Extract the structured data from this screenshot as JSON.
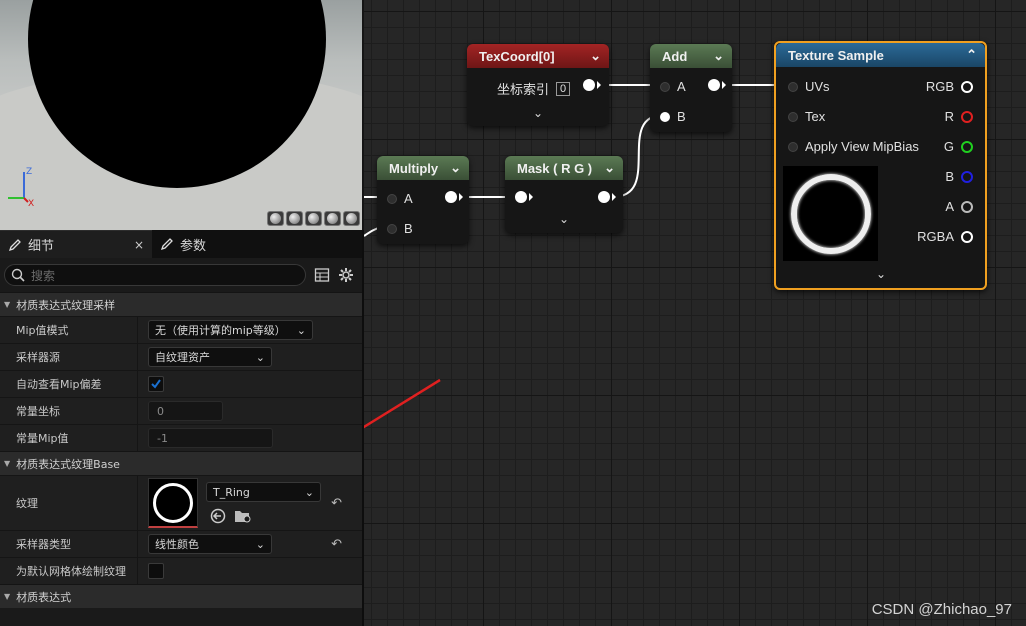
{
  "details": {
    "tabs": [
      {
        "label": "细节",
        "close": "×"
      },
      {
        "label": "参数"
      }
    ],
    "search_placeholder": "搜索",
    "sections": {
      "sampling": "材质表达式纹理采样",
      "base": "材质表达式纹理Base",
      "expr": "材质表达式"
    },
    "props": {
      "mip_mode_label": "Mip值模式",
      "mip_mode_value": "无（使用计算的mip等级）",
      "sampler_source_label": "采样器源",
      "sampler_source_value": "自纹理资产",
      "auto_mip_label": "自动查看Mip偏差",
      "auto_mip_checked": true,
      "const_coord_label": "常量坐标",
      "const_coord_value": "0",
      "const_mip_label": "常量Mip值",
      "const_mip_value": "-1",
      "texture_label": "纹理",
      "texture_value": "T_Ring",
      "sampler_type_label": "采样器类型",
      "sampler_type_value": "线性颜色",
      "default_mesh_label": "为默认网格体绘制纹理",
      "default_mesh_checked": false
    }
  },
  "graph": {
    "nodes": {
      "texcoord": {
        "title": "TexCoord[0]",
        "param_label": "坐标索引",
        "param_value": "0",
        "color": "#8c1c1c"
      },
      "add": {
        "title": "Add",
        "pins": [
          "A",
          "B"
        ],
        "color": "#3f5a3a"
      },
      "multiply": {
        "title": "Multiply",
        "pins": [
          "A",
          "B"
        ],
        "color": "#3f5a3a"
      },
      "mask": {
        "title": "Mask ( R G )",
        "color": "#3f5a3a"
      },
      "texture_sample": {
        "title": "Texture Sample",
        "color": "#1f5278",
        "inputs": [
          "UVs",
          "Tex",
          "Apply View MipBias"
        ],
        "outputs": [
          "RGB",
          "R",
          "G",
          "B",
          "A",
          "RGBA"
        ],
        "output_colors": [
          "#ffffff",
          "#e02020",
          "#20d020",
          "#2020e0",
          "#bbbbbb",
          "#ffffff"
        ]
      }
    }
  },
  "watermark": "CSDN @Zhichao_97",
  "colors": {
    "selection": "#f0a020",
    "annotation_arrow": "#e02020",
    "check": "#1a70d0"
  }
}
